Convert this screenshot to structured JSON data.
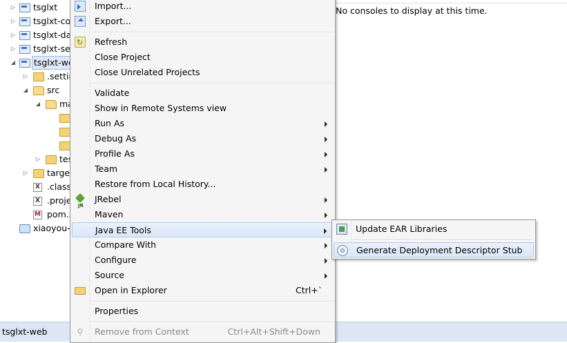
{
  "tree": {
    "items": [
      {
        "label": "tsglxt",
        "twisty": "▷"
      },
      {
        "label": "tsglxt-cor",
        "twisty": "▷"
      },
      {
        "label": "tsglxt-da",
        "twisty": "▷"
      },
      {
        "label": "tsglxt-ser",
        "twisty": "▷"
      },
      {
        "label": "tsglxt-we",
        "twisty": "◢"
      },
      {
        "label": ".settin",
        "twisty": "▷"
      },
      {
        "label": "src",
        "twisty": "◢"
      },
      {
        "label": "ma",
        "twisty": "◢"
      },
      {
        "label": "tes",
        "twisty": "▷"
      },
      {
        "label": "target",
        "twisty": "▷"
      },
      {
        "label": ".classp",
        "icon_text": "X"
      },
      {
        "label": ".proje",
        "icon_text": "X"
      },
      {
        "label": "pom.x",
        "icon_text": "M"
      },
      {
        "label": "xiaoyou-w"
      }
    ]
  },
  "console": {
    "message": "No consoles to display at this time."
  },
  "status": {
    "text": "tsglxt-web"
  },
  "context_menu": {
    "items": [
      {
        "label": "Import...",
        "icon": "import-icon"
      },
      {
        "label": "Export...",
        "icon": "export-icon"
      },
      {
        "label": "Refresh",
        "icon": "refresh-icon"
      },
      {
        "label": "Close Project"
      },
      {
        "label": "Close Unrelated Projects"
      },
      {
        "label": "Validate"
      },
      {
        "label": "Show in Remote Systems view"
      },
      {
        "label": "Run As",
        "submenu": true
      },
      {
        "label": "Debug As",
        "submenu": true
      },
      {
        "label": "Profile As",
        "submenu": true
      },
      {
        "label": "Team",
        "submenu": true
      },
      {
        "label": "Restore from Local History..."
      },
      {
        "label": "JRebel",
        "icon": "jrebel-icon",
        "submenu": true
      },
      {
        "label": "Maven",
        "submenu": true
      },
      {
        "label": "Java EE Tools",
        "submenu": true,
        "highlighted": true
      },
      {
        "label": "Compare With",
        "submenu": true
      },
      {
        "label": "Configure",
        "submenu": true
      },
      {
        "label": "Source",
        "submenu": true
      },
      {
        "label": "Open in Explorer",
        "icon": "folder-icon",
        "shortcut": "Ctrl+`"
      },
      {
        "label": "Properties"
      },
      {
        "label": "Remove from Context",
        "icon": "remove-icon",
        "shortcut": "Ctrl+Alt+Shift+Down",
        "disabled": true
      }
    ]
  },
  "java_ee_submenu": {
    "items": [
      {
        "label": "Update EAR Libraries",
        "icon": "ear-libraries-icon"
      },
      {
        "label": "Generate Deployment Descriptor Stub",
        "icon": "deployment-descriptor-icon",
        "highlighted": true
      }
    ]
  }
}
